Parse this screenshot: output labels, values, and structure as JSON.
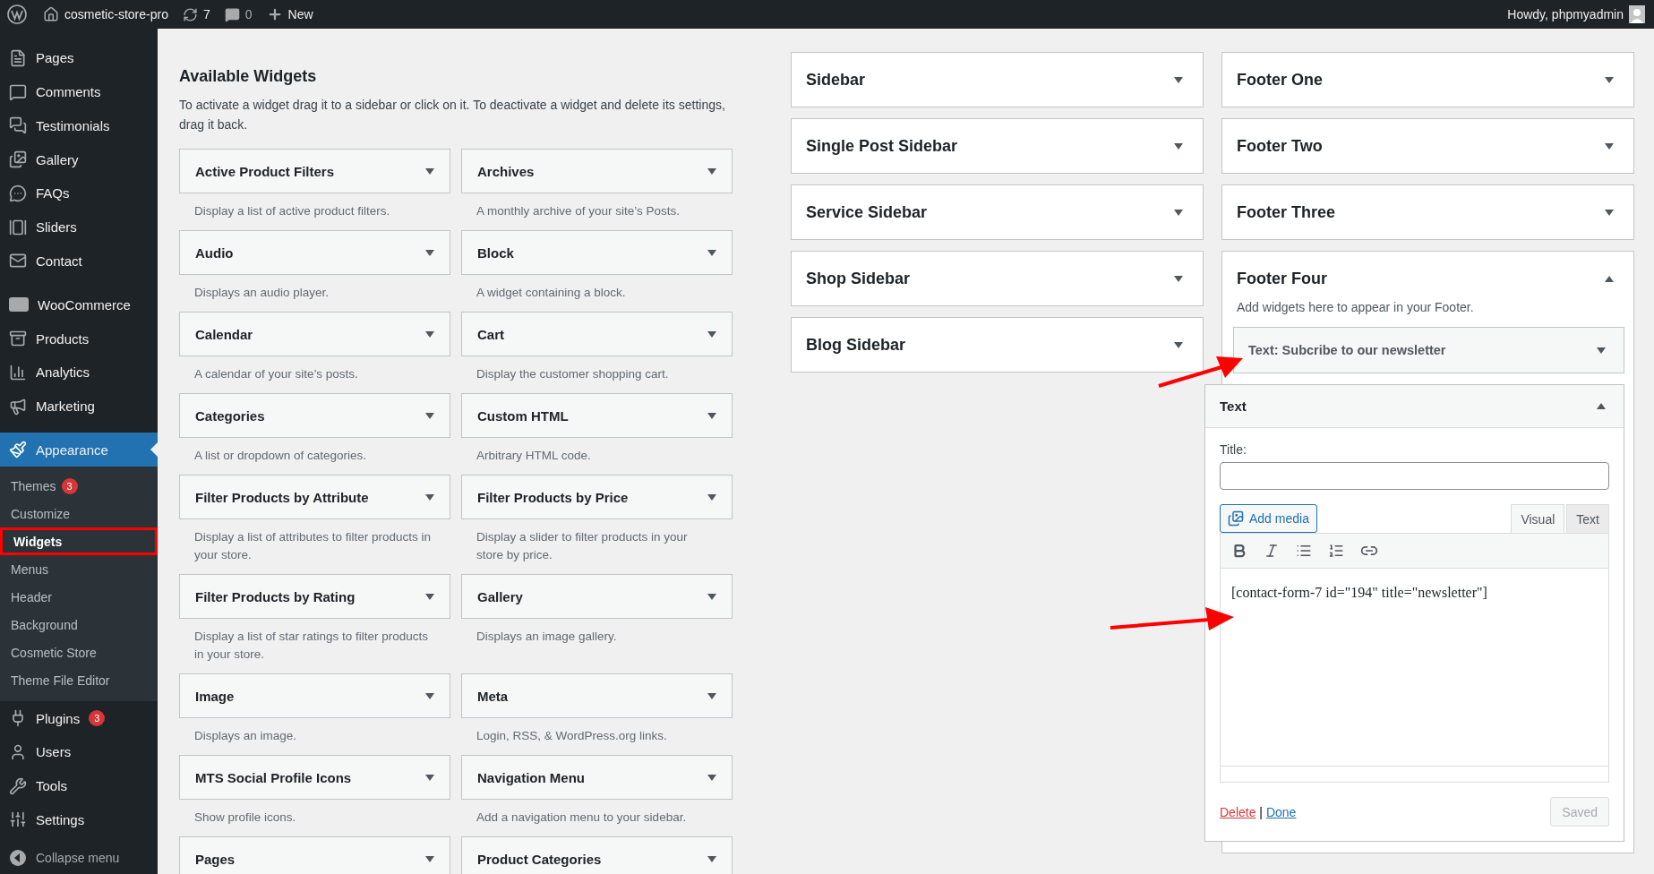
{
  "admin_bar": {
    "site_name": "cosmetic-store-pro",
    "updates": "7",
    "comments": "0",
    "new_label": "New",
    "greeting": "Howdy, phpmyadmin"
  },
  "menu": [
    {
      "label": "Pages",
      "selected": false,
      "separator_before": false
    },
    {
      "label": "Comments",
      "selected": false,
      "separator_before": false
    },
    {
      "label": "Testimonials",
      "selected": false,
      "separator_before": false
    },
    {
      "label": "Gallery",
      "selected": false,
      "separator_before": false
    },
    {
      "label": "FAQs",
      "selected": false,
      "separator_before": false
    },
    {
      "label": "Sliders",
      "selected": false,
      "separator_before": false
    },
    {
      "label": "Contact",
      "selected": false,
      "separator_before": false
    },
    {
      "label": "WooCommerce",
      "selected": false,
      "separator_before": true
    },
    {
      "label": "Products",
      "selected": false,
      "separator_before": false
    },
    {
      "label": "Analytics",
      "selected": false,
      "separator_before": false
    },
    {
      "label": "Marketing",
      "selected": false,
      "separator_before": false
    },
    {
      "label": "Appearance",
      "selected": true,
      "separator_before": true,
      "children": [
        {
          "label": "Themes",
          "badge": "3",
          "selected": false,
          "annotated": false
        },
        {
          "label": "Customize",
          "selected": false,
          "annotated": false
        },
        {
          "label": "Widgets",
          "selected": true,
          "annotated": true
        },
        {
          "label": "Menus",
          "selected": false,
          "annotated": false
        },
        {
          "label": "Header",
          "selected": false,
          "annotated": false
        },
        {
          "label": "Background",
          "selected": false,
          "annotated": false
        },
        {
          "label": "Cosmetic Store",
          "selected": false,
          "annotated": false
        },
        {
          "label": "Theme File Editor",
          "selected": false,
          "annotated": false
        }
      ]
    },
    {
      "label": "Plugins",
      "badge": "3",
      "selected": false,
      "separator_before": false
    },
    {
      "label": "Users",
      "selected": false,
      "separator_before": false
    },
    {
      "label": "Tools",
      "selected": false,
      "separator_before": false
    },
    {
      "label": "Settings",
      "selected": false,
      "separator_before": false
    }
  ],
  "collapse_menu": "Collapse menu",
  "available_widgets": {
    "title": "Available Widgets",
    "description": "To activate a widget drag it to a sidebar or click on it. To deactivate a widget and delete its settings, drag it back.",
    "widgets": [
      {
        "name": "Active Product Filters",
        "description": "Display a list of active product filters."
      },
      {
        "name": "Archives",
        "description": "A monthly archive of your site’s Posts."
      },
      {
        "name": "Audio",
        "description": "Displays an audio player."
      },
      {
        "name": "Block",
        "description": "A widget containing a block."
      },
      {
        "name": "Calendar",
        "description": "A calendar of your site’s posts."
      },
      {
        "name": "Cart",
        "description": "Display the customer shopping cart."
      },
      {
        "name": "Categories",
        "description": "A list or dropdown of categories."
      },
      {
        "name": "Custom HTML",
        "description": "Arbitrary HTML code."
      },
      {
        "name": "Filter Products by Attribute",
        "description": "Display a list of attributes to filter products in your store."
      },
      {
        "name": "Filter Products by Price",
        "description": "Display a slider to filter products in your store by price."
      },
      {
        "name": "Filter Products by Rating",
        "description": "Display a list of star ratings to filter products in your store."
      },
      {
        "name": "Gallery",
        "description": "Displays an image gallery."
      },
      {
        "name": "Image",
        "description": "Displays an image."
      },
      {
        "name": "Meta",
        "description": "Login, RSS, & WordPress.org links."
      },
      {
        "name": "MTS Social Profile Icons",
        "description": "Show profile icons."
      },
      {
        "name": "Navigation Menu",
        "description": "Add a navigation menu to your sidebar."
      },
      {
        "name": "Pages"
      },
      {
        "name": "Product Categories"
      }
    ]
  },
  "sidebar_columns": [
    [
      {
        "name": "Sidebar",
        "expanded": false
      },
      {
        "name": "Single Post Sidebar",
        "expanded": false
      },
      {
        "name": "Service Sidebar",
        "expanded": false
      },
      {
        "name": "Shop Sidebar",
        "expanded": false
      },
      {
        "name": "Blog Sidebar",
        "expanded": false
      }
    ],
    [
      {
        "name": "Footer One",
        "expanded": false
      },
      {
        "name": "Footer Two",
        "expanded": false
      },
      {
        "name": "Footer Three",
        "expanded": false
      },
      {
        "name": "Footer Four",
        "expanded": true,
        "description": "Add widgets here to appear in your Footer.",
        "widgets": [
          {
            "title": "**Text:** Subcribe to our newsletter",
            "expanded": false
          }
        ],
        "open_widget": {
          "title": "Text",
          "expanded": true,
          "title_label": "Title:",
          "add_media": "Add media",
          "tabs": [
            {
              "label": "Visual",
              "selected": true
            },
            {
              "label": "Text",
              "selected": false
            }
          ],
          "content": "[contact-form-7 id=\"194\" title=\"newsletter\"]",
          "delete": "Delete",
          "separator": "|",
          "done": "Done",
          "save": "Saved",
          "save_disabled": true
        }
      }
    ]
  ]
}
